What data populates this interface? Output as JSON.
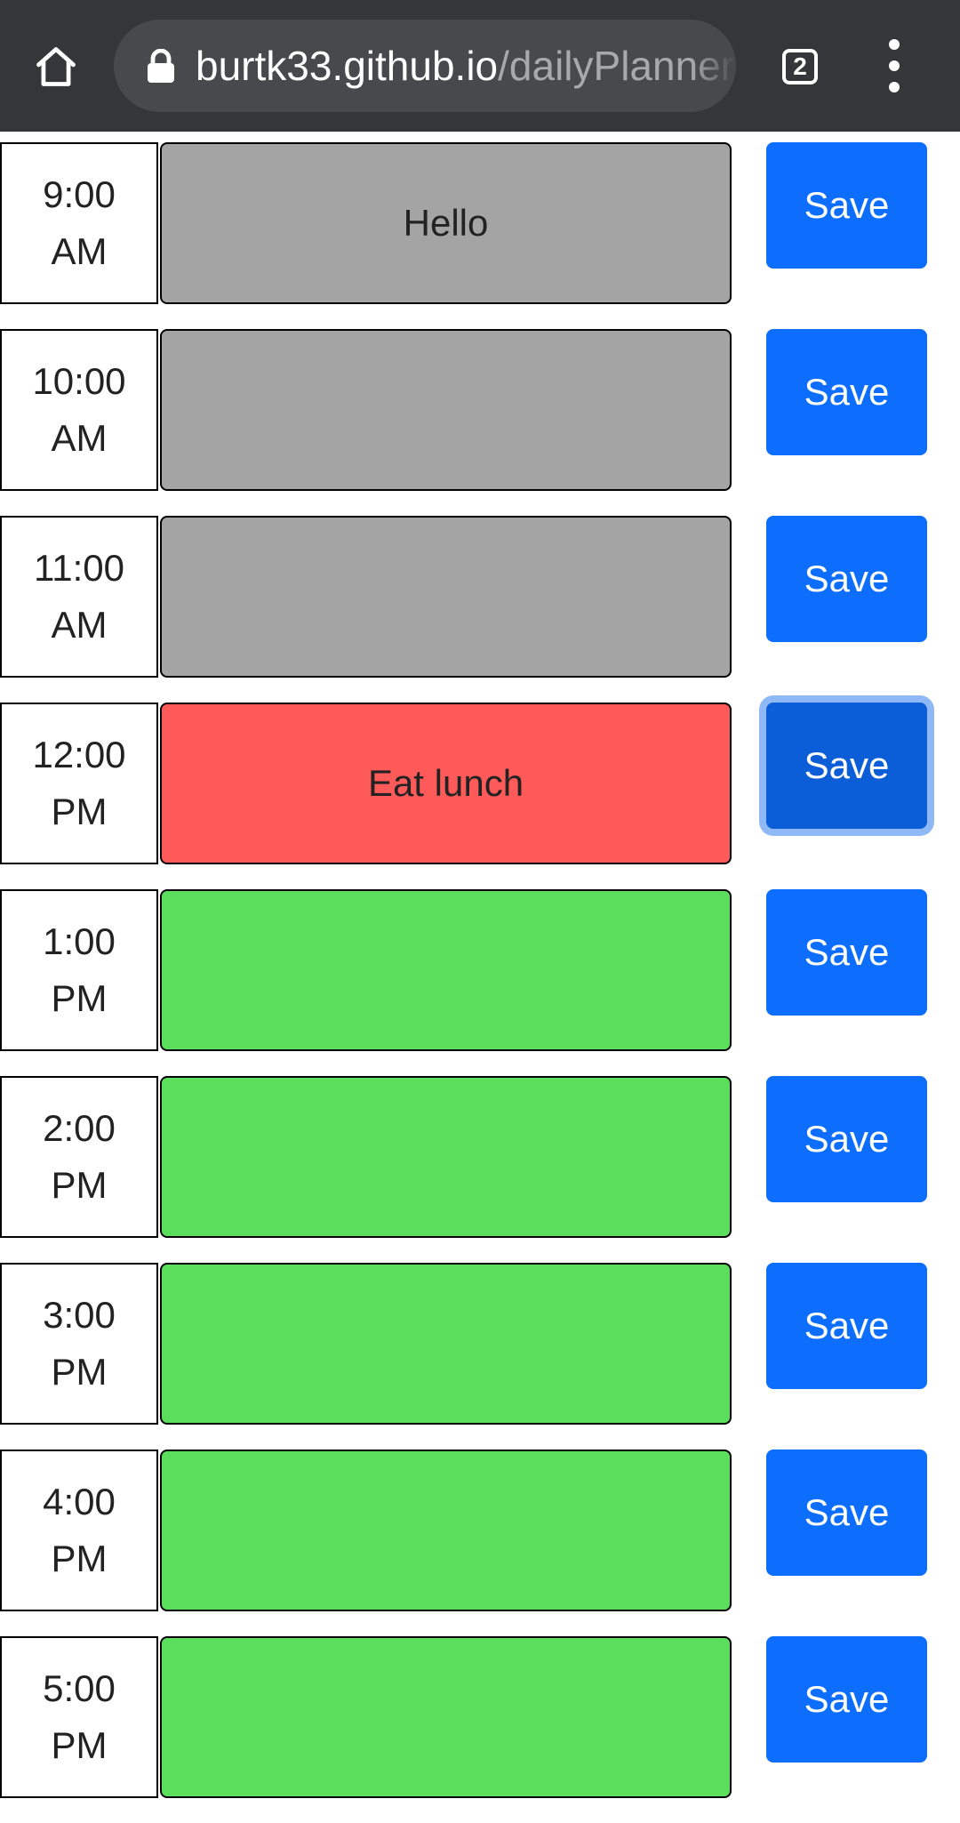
{
  "browser": {
    "url_host": "burtk33.github.io",
    "url_path": "/dailyPlanner",
    "tab_count": "2"
  },
  "planner": {
    "rows": [
      {
        "hour_top": "9:00",
        "hour_bottom": "AM",
        "text": "Hello",
        "state": "past",
        "save_label": "Save"
      },
      {
        "hour_top": "10:00",
        "hour_bottom": "AM",
        "text": "",
        "state": "past",
        "save_label": "Save"
      },
      {
        "hour_top": "11:00",
        "hour_bottom": "AM",
        "text": "",
        "state": "past",
        "save_label": "Save"
      },
      {
        "hour_top": "12:00",
        "hour_bottom": "PM",
        "text": "Eat lunch",
        "state": "present",
        "save_label": "Save"
      },
      {
        "hour_top": "1:00",
        "hour_bottom": "PM",
        "text": "",
        "state": "future",
        "save_label": "Save"
      },
      {
        "hour_top": "2:00",
        "hour_bottom": "PM",
        "text": "",
        "state": "future",
        "save_label": "Save"
      },
      {
        "hour_top": "3:00",
        "hour_bottom": "PM",
        "text": "",
        "state": "future",
        "save_label": "Save"
      },
      {
        "hour_top": "4:00",
        "hour_bottom": "PM",
        "text": "",
        "state": "future",
        "save_label": "Save"
      },
      {
        "hour_top": "5:00",
        "hour_bottom": "PM",
        "text": "",
        "state": "future",
        "save_label": "Save"
      }
    ],
    "focused_save_index": 3
  },
  "colors": {
    "past": "#a4a4a4",
    "present": "#ff5a5a",
    "future": "#5bde5b",
    "save_button": "#0d6efd",
    "browser_bar": "#35363a"
  }
}
